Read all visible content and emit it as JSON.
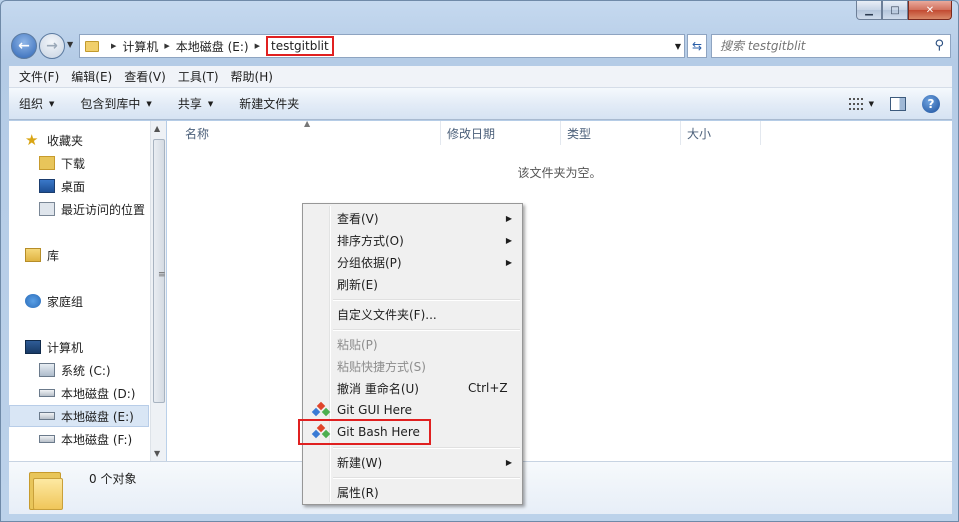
{
  "window": {
    "caption": {
      "minimize": "▁",
      "maximize": "□",
      "close": "✕"
    }
  },
  "address_bar": {
    "breadcrumbs": [
      {
        "label": "计算机"
      },
      {
        "label": "本地磁盘 (E:)"
      },
      {
        "label": "testgitblit",
        "highlighted": true
      }
    ]
  },
  "search": {
    "placeholder": "搜索 testgitblit"
  },
  "menubar": [
    "文件(F)",
    "编辑(E)",
    "查看(V)",
    "工具(T)",
    "帮助(H)"
  ],
  "toolbar": {
    "organize": "组织",
    "include_in_library": "包含到库中",
    "share": "共享",
    "new_folder": "新建文件夹"
  },
  "nav_pane": {
    "favorites": {
      "label": "收藏夹",
      "items": [
        "下载",
        "桌面",
        "最近访问的位置"
      ]
    },
    "libraries": {
      "label": "库"
    },
    "homegroup": {
      "label": "家庭组"
    },
    "computer": {
      "label": "计算机",
      "items": [
        "系统 (C:)",
        "本地磁盘 (D:)",
        "本地磁盘 (E:)",
        "本地磁盘 (F:)"
      ],
      "selected": "本地磁盘 (E:)"
    }
  },
  "file_list": {
    "columns": [
      "名称",
      "修改日期",
      "类型",
      "大小"
    ],
    "empty_message": "该文件夹为空。"
  },
  "details_pane": {
    "item_count": "0 个对象"
  },
  "context_menu": {
    "items": [
      {
        "label": "查看(V)",
        "submenu": true
      },
      {
        "label": "排序方式(O)",
        "submenu": true
      },
      {
        "label": "分组依据(P)",
        "submenu": true
      },
      {
        "label": "刷新(E)"
      },
      {
        "label": "自定义文件夹(F)..."
      },
      {
        "label": "粘贴(P)",
        "disabled": true
      },
      {
        "label": "粘贴快捷方式(S)",
        "disabled": true
      },
      {
        "label": "撤消 重命名(U)",
        "shortcut": "Ctrl+Z"
      },
      {
        "label": "Git GUI Here",
        "icon": "git-icon"
      },
      {
        "label": "Git Bash Here",
        "icon": "git-icon",
        "highlighted": true
      },
      {
        "label": "新建(W)",
        "submenu": true
      },
      {
        "label": "属性(R)"
      }
    ]
  },
  "colors": {
    "highlight_box": "#e02020",
    "git_red": "#e0452b",
    "git_blue": "#3a7bd5",
    "git_green": "#4caf50"
  }
}
